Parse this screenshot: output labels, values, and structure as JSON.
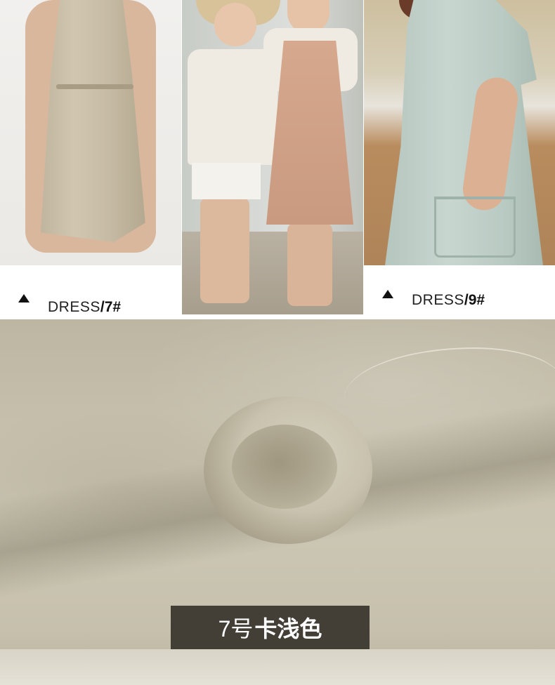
{
  "panels": [
    {
      "caption_label": "DRESS",
      "caption_number": "/7#"
    },
    {
      "caption_label": "",
      "caption_number": ""
    },
    {
      "caption_label": "DRESS",
      "caption_number": "/9#"
    }
  ],
  "fabric": {
    "color_code": "7号",
    "color_name": "卡浅色"
  },
  "colors": {
    "fabric": "#c7c1ae",
    "badge_background": "#37342d",
    "dress_7": "#cabfa7",
    "dress_9": "#c0d0c9",
    "apron": "#cfa086"
  },
  "icons": {
    "caption_marker": "triangle-up-icon"
  }
}
